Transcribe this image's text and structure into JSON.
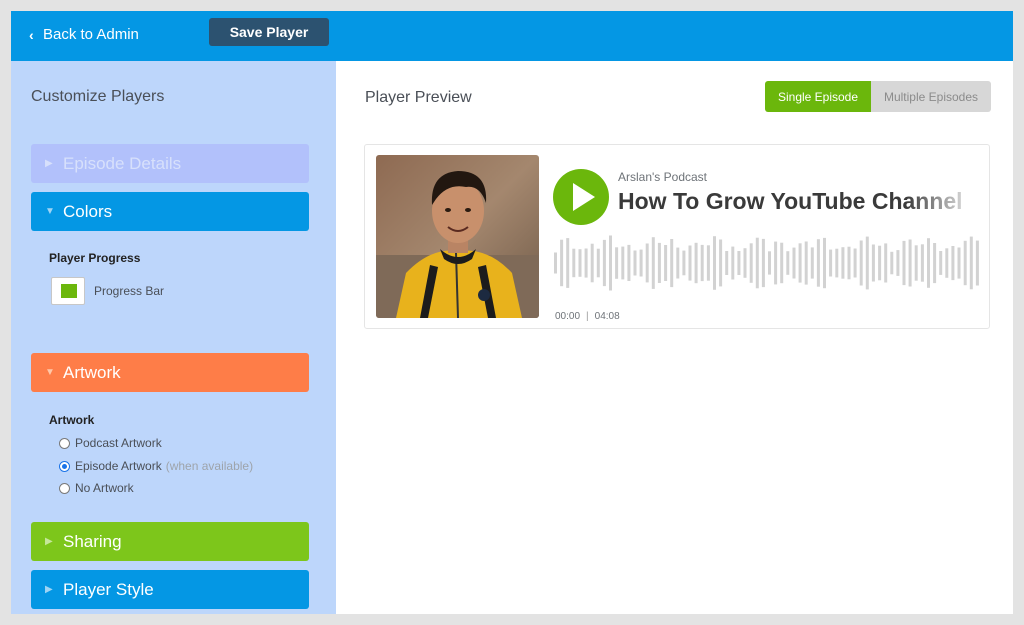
{
  "header": {
    "back_label": "Back to Admin",
    "save_label": "Save Player"
  },
  "sidebar": {
    "title": "Customize Players",
    "sections": {
      "episode_details": "Episode Details",
      "colors": "Colors",
      "artwork": "Artwork",
      "sharing": "Sharing",
      "player_style": "Player Style"
    },
    "colors_panel": {
      "heading": "Player Progress",
      "swatch_label": "Progress Bar",
      "swatch_color": "#6bb70c"
    },
    "artwork_panel": {
      "heading": "Artwork",
      "options": [
        {
          "label": "Podcast Artwork",
          "note": "",
          "checked": false
        },
        {
          "label": "Episode Artwork",
          "note": "(when available)",
          "checked": true
        },
        {
          "label": "No Artwork",
          "note": "",
          "checked": false
        }
      ]
    }
  },
  "main": {
    "title": "Player Preview",
    "toggle": {
      "single": "Single Episode",
      "multiple": "Multiple Episodes",
      "selected": "single"
    },
    "player": {
      "podcast": "Arslan's Podcast",
      "episode_title": "How To Grow YouTube Channel",
      "current_time": "00:00",
      "separator": "|",
      "duration": "04:08",
      "progress": 0
    }
  },
  "colors": {
    "topbar": "#0497e4",
    "accent_green": "#6bb70c",
    "artwork_orange": "#fe7d48",
    "save_button": "#2c5270"
  }
}
